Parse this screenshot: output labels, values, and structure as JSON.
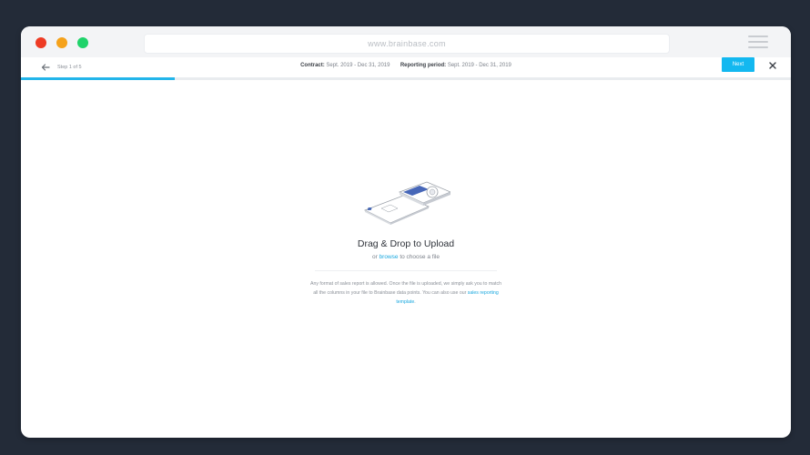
{
  "browser": {
    "url": "www.brainbase.com"
  },
  "header": {
    "step": "Step 1 of 5",
    "contract_label": "Contract:",
    "contract_value": "Sept. 2019 - Dec 31, 2019",
    "reporting_label": "Reporting period:",
    "reporting_value": "Sept. 2019 - Dec 31, 2019",
    "next_label": "Next"
  },
  "progress": {
    "fraction": 0.2,
    "color": "#23b5ea"
  },
  "upload": {
    "title": "Drag & Drop to Upload",
    "or_text": "or ",
    "browse_link": "browse",
    "choose_text": " to choose a file",
    "note_text": "Any format of sales report is allowed. Once the file is uploaded, we simply ask you to match all the columns in your file to Brainbase data points. You can also use our ",
    "template_link": "sales reporting template",
    "note_end": "."
  },
  "icons": {
    "back": "arrow-left-icon",
    "close": "close-icon",
    "menu": "hamburger-menu-icon",
    "illustration": "file-upload-illustration"
  },
  "colors": {
    "accent": "#13b8f0",
    "background": "#232b38",
    "traffic_red": "#ee3b24",
    "traffic_yellow": "#f5a21b",
    "traffic_green": "#1fd36a"
  }
}
